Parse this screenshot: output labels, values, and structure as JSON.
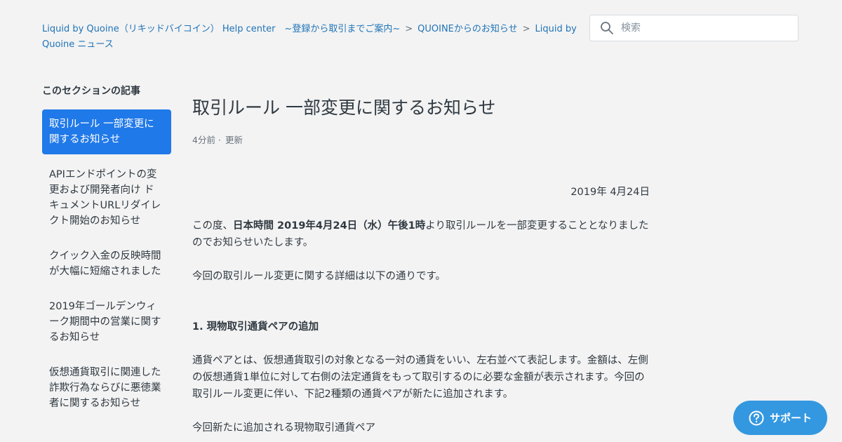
{
  "breadcrumbs": [
    "Liquid by Quoine（リキッドバイコイン） Help center　~登録から取引までご案内~",
    "QUOINEからのお知らせ",
    "Liquid by Quoine ニュース"
  ],
  "breadcrumb_separator": ">",
  "search": {
    "placeholder": "検索"
  },
  "sidebar": {
    "title": "このセクションの記事",
    "items": [
      "取引ルール 一部変更に関するお知らせ",
      "APIエンドポイントの変更および開発者向け ドキュメントURLリダイレクト開始のお知らせ",
      "クイック入金の反映時間が大幅に短縮されました",
      "2019年ゴールデンウィーク期間中の営業に関するお知らせ",
      "仮想通貨取引に関連した詐欺行為ならびに悪徳業者に関するお知らせ"
    ]
  },
  "article": {
    "title": "取引ルール 一部変更に関するお知らせ",
    "meta_time": "4分前",
    "meta_dot": "·",
    "meta_updated": "更新",
    "date": "2019年 4月24日",
    "intro_prefix": "この度、",
    "intro_bold": "日本時間 2019年4月24日（水）午後1時",
    "intro_suffix": "より取引ルールを一部変更することとなりましたのでお知らせいたします。",
    "para2": "今回の取引ルール変更に関する詳細は以下の通りです。",
    "section1_heading": "1. 現物取引通貨ペアの追加",
    "section1_text": "通貨ペアとは、仮想通貨取引の対象となる一対の通貨をいい、左右並べて表記します。金額は、左側の仮想通貨1単位に対して右側の法定通貨をもって取引するのに必要な金額が表示されます。今回の取引ルール変更に伴い、下記2種類の通貨ペアが新たに追加されます。",
    "section1_sub": "今回新たに追加される現物取引通貨ペア"
  },
  "support_button": {
    "label": "サポート"
  },
  "colors": {
    "accent": "#2079e8",
    "link": "#1f73b7",
    "support": "#3498e0"
  }
}
